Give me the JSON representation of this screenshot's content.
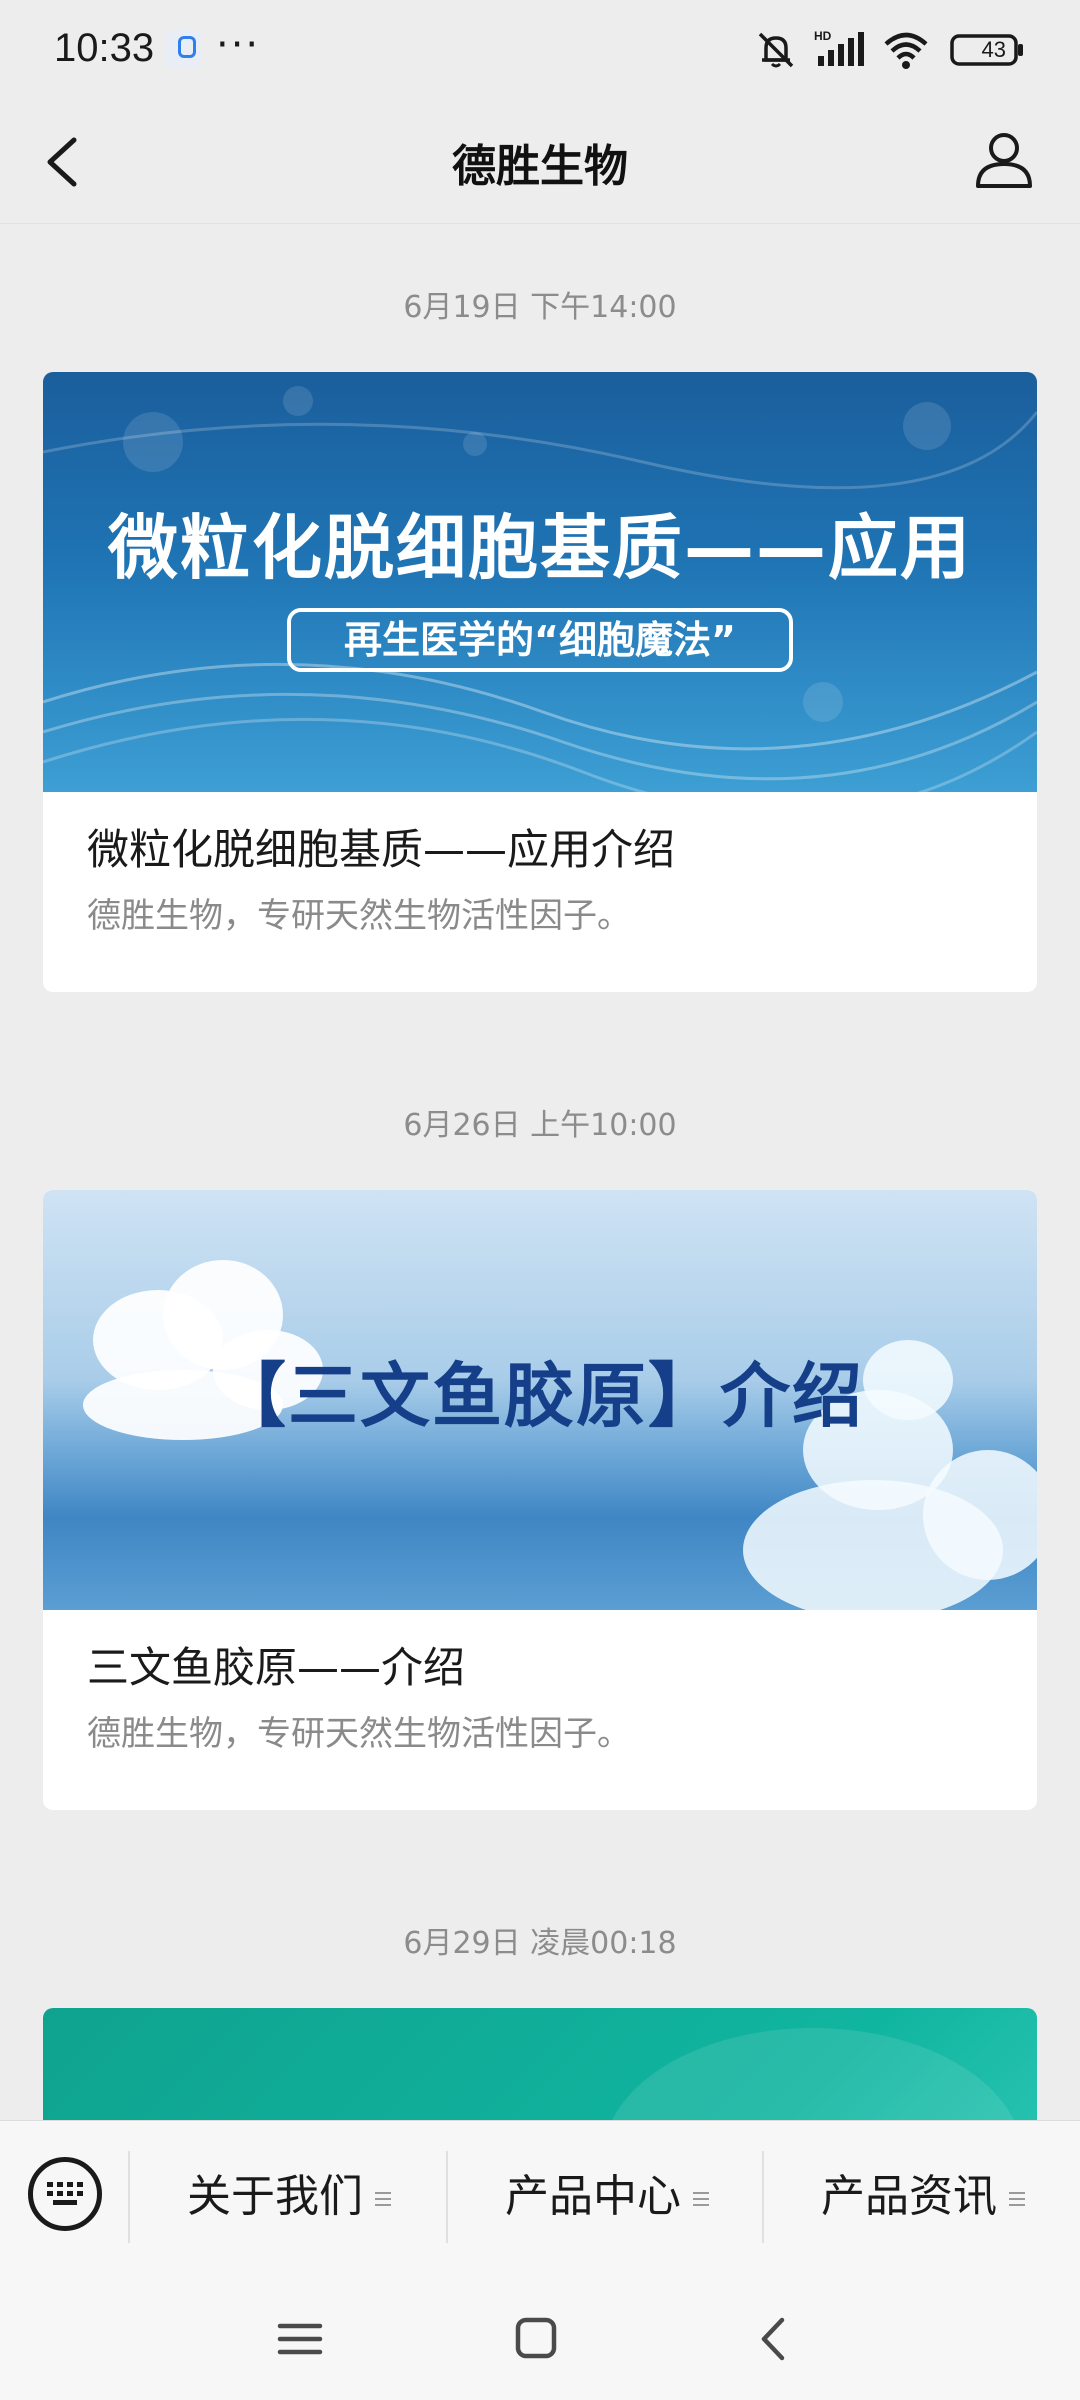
{
  "status_bar": {
    "time": "10:33",
    "dots": "···",
    "network": "HD",
    "battery": "43"
  },
  "nav": {
    "title": "德胜生物"
  },
  "feed": [
    {
      "timestamp": "6月19日 下午14:00",
      "cover_title": "微粒化脱细胞基质——应用",
      "cover_subtitle": "再生医学的“细胞魔法”",
      "title": "微粒化脱细胞基质——应用介绍",
      "description": "德胜生物，专研天然生物活性因子。"
    },
    {
      "timestamp": "6月26日 上午10:00",
      "cover_title": "【三文鱼胶原】介绍",
      "title": "三文鱼胶原——介绍",
      "description": "德胜生物，专研天然生物活性因子。"
    },
    {
      "timestamp": "6月29日 凌晨00:18"
    }
  ],
  "menu": {
    "items": [
      {
        "label": "关于我们"
      },
      {
        "label": "产品中心"
      },
      {
        "label": "产品资讯"
      }
    ]
  },
  "icons": {
    "back": "chevron-left-icon",
    "profile": "person-icon",
    "keyboard": "keyboard-icon"
  }
}
